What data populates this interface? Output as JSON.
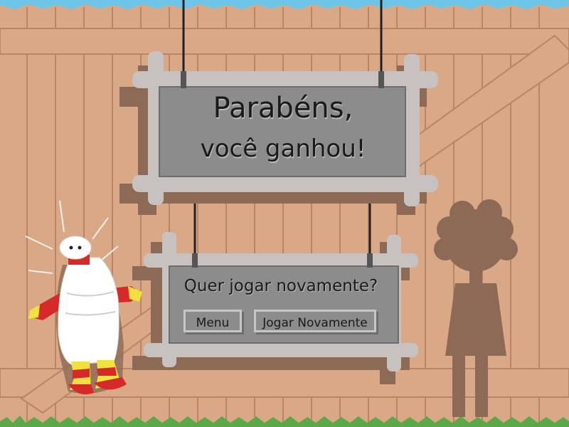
{
  "win_sign": {
    "line1": "Parabéns,",
    "line2": "você ganhou!"
  },
  "replay_sign": {
    "question": "Quer jogar novamente?",
    "menu_label": "Menu",
    "play_again_label": "Jogar Novamente"
  },
  "colors": {
    "fence": "#d8a887",
    "fence_line": "#b98566",
    "sign_frame": "#c7c2bf",
    "sign_board": "#8c8c8c",
    "shadow": "#8d6a55",
    "silhouette": "#8d6a55",
    "red": "#d62a2a",
    "yellow": "#f0e040",
    "sky": "#6ec5e8",
    "grass": "#5aa84a"
  }
}
